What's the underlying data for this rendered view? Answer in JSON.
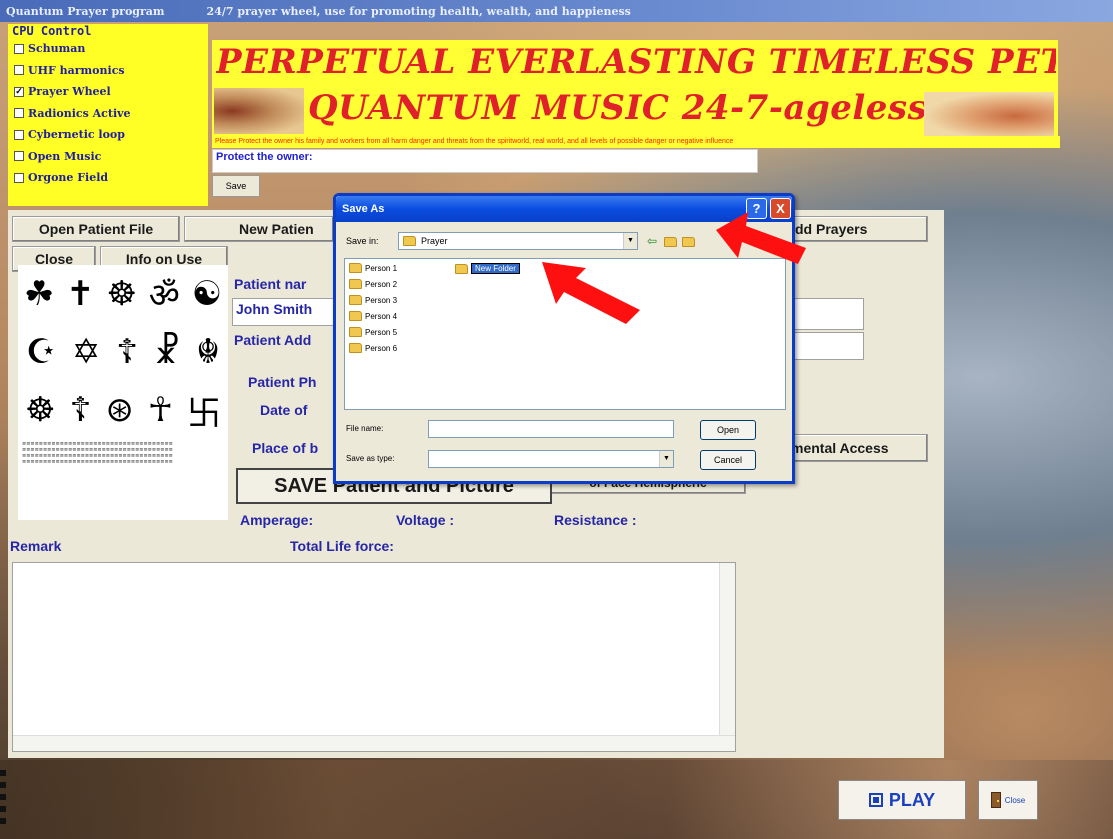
{
  "window": {
    "app_name": "Quantum Prayer program",
    "tagline": "24/7  prayer wheel, use for promoting health, wealth, and happieness"
  },
  "cpu_control": {
    "title": "CPU Control",
    "items": [
      {
        "label": "Schuman",
        "checked": false
      },
      {
        "label": "UHF harmonics",
        "checked": false
      },
      {
        "label": "Prayer Wheel",
        "checked": true
      },
      {
        "label": "Radionics Active",
        "checked": false
      },
      {
        "label": "Cybernetic loop",
        "checked": false
      },
      {
        "label": "Open Music",
        "checked": false
      },
      {
        "label": "Orgone Field",
        "checked": false
      }
    ]
  },
  "banner": {
    "line1": "PERPETUAL EVERLASTING TIMELESS PET",
    "line2": "QUANTUM MUSIC  24-7-ageless",
    "note": "Please Protect the owner his family and workers from all harm danger and threats from the spiritworld, real world, and all levels of possible danger or negative influence"
  },
  "protect": {
    "value": "Protect the owner:",
    "save_label": "Save"
  },
  "patient": {
    "open_file": "Open Patient File",
    "new_patient": "New Patien",
    "add_prayers": "dd Prayers",
    "close": "Close",
    "info": "Info on Use",
    "name_label": "Patient nar",
    "name_value": "John Smith",
    "address_label": "Patient Add",
    "photo_label": "Patient Ph",
    "date_label": "Date of",
    "place_label": "Place of b",
    "mental_access": "mental Access",
    "save_patient": "SAVE Patient and Picture",
    "hemisphere": "of Face Hemispheric",
    "amperage": "Amperage:",
    "voltage": "Voltage :",
    "resistance": "Resistance :",
    "remark": "Remark",
    "life_force": "Total Life force:"
  },
  "dialog": {
    "title": "Save As",
    "help": "?",
    "close": "X",
    "save_in_label": "Save in:",
    "save_in_value": "Prayer",
    "files": [
      "Person 1",
      "Person 2",
      "Person 3",
      "Person 4",
      "Person 5",
      "Person 6"
    ],
    "new_folder": "New Folder",
    "file_name_label": "File name:",
    "file_name_value": "",
    "save_type_label": "Save as type:",
    "save_type_value": "",
    "open": "Open",
    "cancel": "Cancel"
  },
  "bottom": {
    "play": "PLAY",
    "close": "Close"
  },
  "colors": {
    "banner_yellow": "#ffff33",
    "banner_red": "#e0202a",
    "label_blue": "#2626a6",
    "dialog_blue": "#0a4ce0"
  }
}
